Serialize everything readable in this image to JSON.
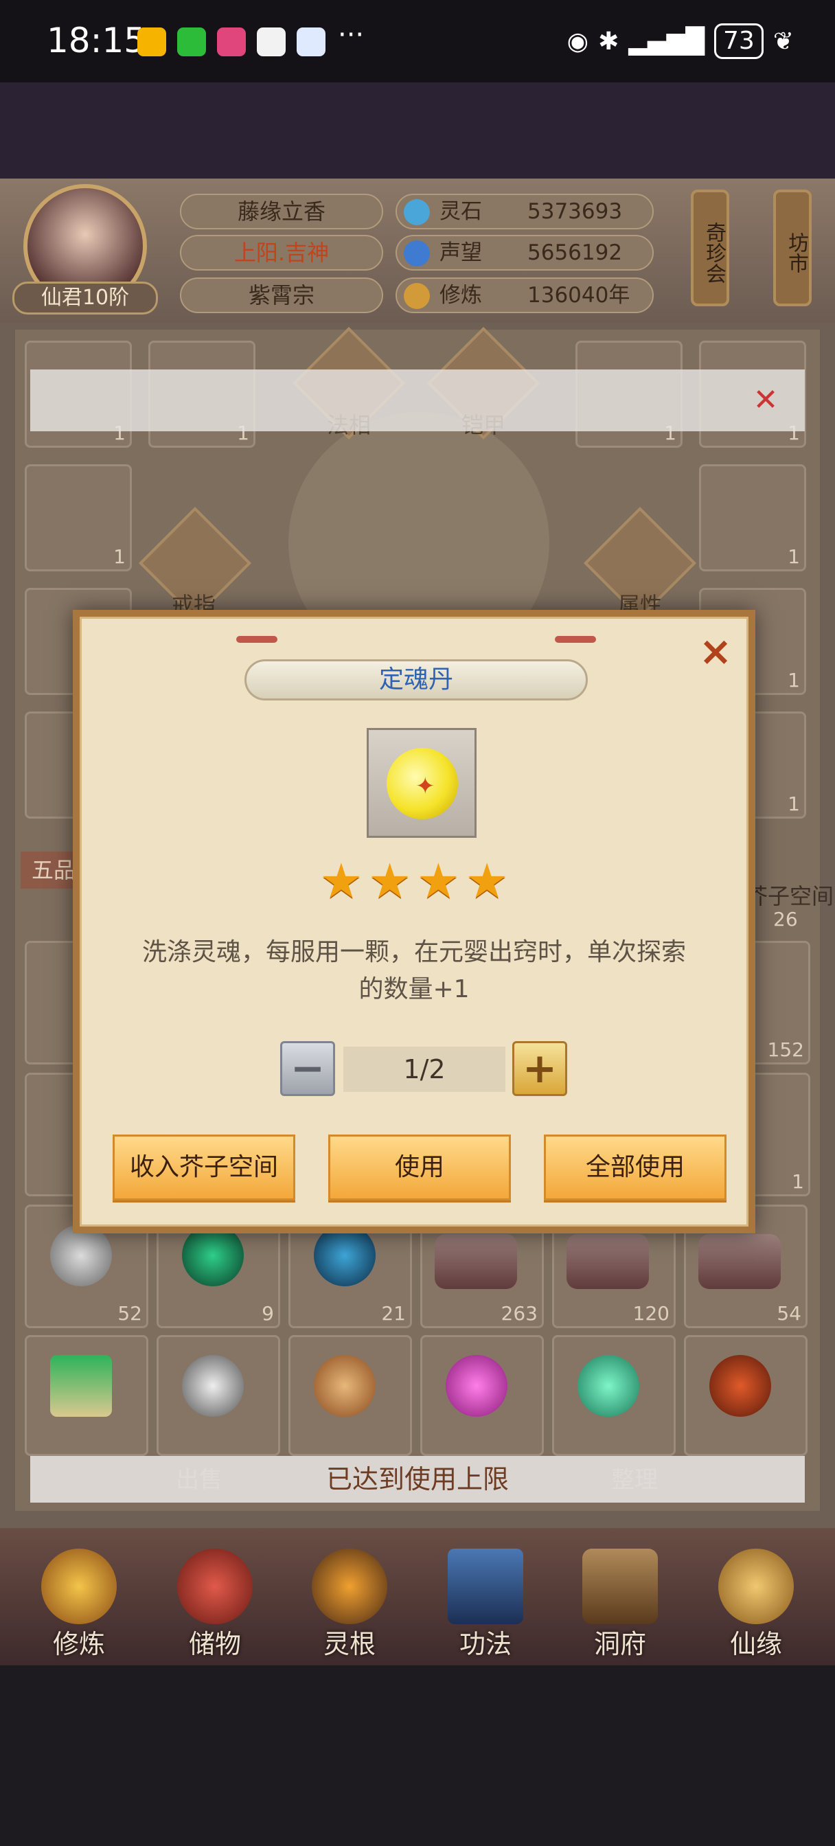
{
  "status_bar": {
    "time": "18:15",
    "more": "···",
    "battery": "73",
    "app_icons": [
      "mail-app-icon",
      "wechat-icon",
      "bilibili-icon",
      "qq-icon",
      "browser-icon"
    ]
  },
  "player": {
    "name": "藤缘立香",
    "title": "上阳.吉神",
    "sect": "紫霄宗",
    "rank": "仙君10阶"
  },
  "resources": [
    {
      "label": "灵石",
      "value": "5373693",
      "icon": "spirit-stone-icon",
      "color": "#4aa6d8"
    },
    {
      "label": "声望",
      "value": "5656192",
      "icon": "reputation-crystal-icon",
      "color": "#3f7bd0"
    },
    {
      "label": "修炼",
      "value": "136040年",
      "icon": "meditation-icon",
      "color": "#d39a3a"
    }
  ],
  "side_tabs": {
    "treasure": "奇珍会",
    "market": "坊市"
  },
  "equipment_slots": {
    "faxiang": "法相",
    "armor": "铠甲",
    "ring": "戒指",
    "attribute": "属性"
  },
  "storage": {
    "tier_label": "五品",
    "space_label": "芥子空间",
    "space_count": "26",
    "visible_counts": {
      "row_a": "152",
      "row_b": "1"
    },
    "item_counts_row": [
      "52",
      "9",
      "21",
      "263",
      "120",
      "54"
    ],
    "equip_counts": [
      "1",
      "1",
      "1",
      "1",
      "1",
      "1",
      "1",
      "1"
    ]
  },
  "bottom_buttons": {
    "sell": "出售",
    "sort": "整理"
  },
  "toast": "已达到使用上限",
  "nav": [
    {
      "label": "修炼",
      "icon": "cultivate-icon"
    },
    {
      "label": "储物",
      "icon": "storage-bag-icon"
    },
    {
      "label": "灵根",
      "icon": "spirit-root-icon"
    },
    {
      "label": "功法",
      "icon": "technique-book-icon"
    },
    {
      "label": "洞府",
      "icon": "cave-dwelling-icon"
    },
    {
      "label": "仙缘",
      "icon": "immortal-fate-icon"
    }
  ],
  "modal": {
    "title": "定魂丹",
    "stars": 4,
    "description_line1": "洗涤灵魂，每服用一颗，在元婴出窍时，单次探索",
    "description_line2": "的数量+1",
    "quantity": "1/2",
    "minus": "−",
    "plus": "+",
    "close": "×",
    "buttons": {
      "store": "收入芥子空间",
      "use": "使用",
      "use_all": "全部使用"
    }
  }
}
